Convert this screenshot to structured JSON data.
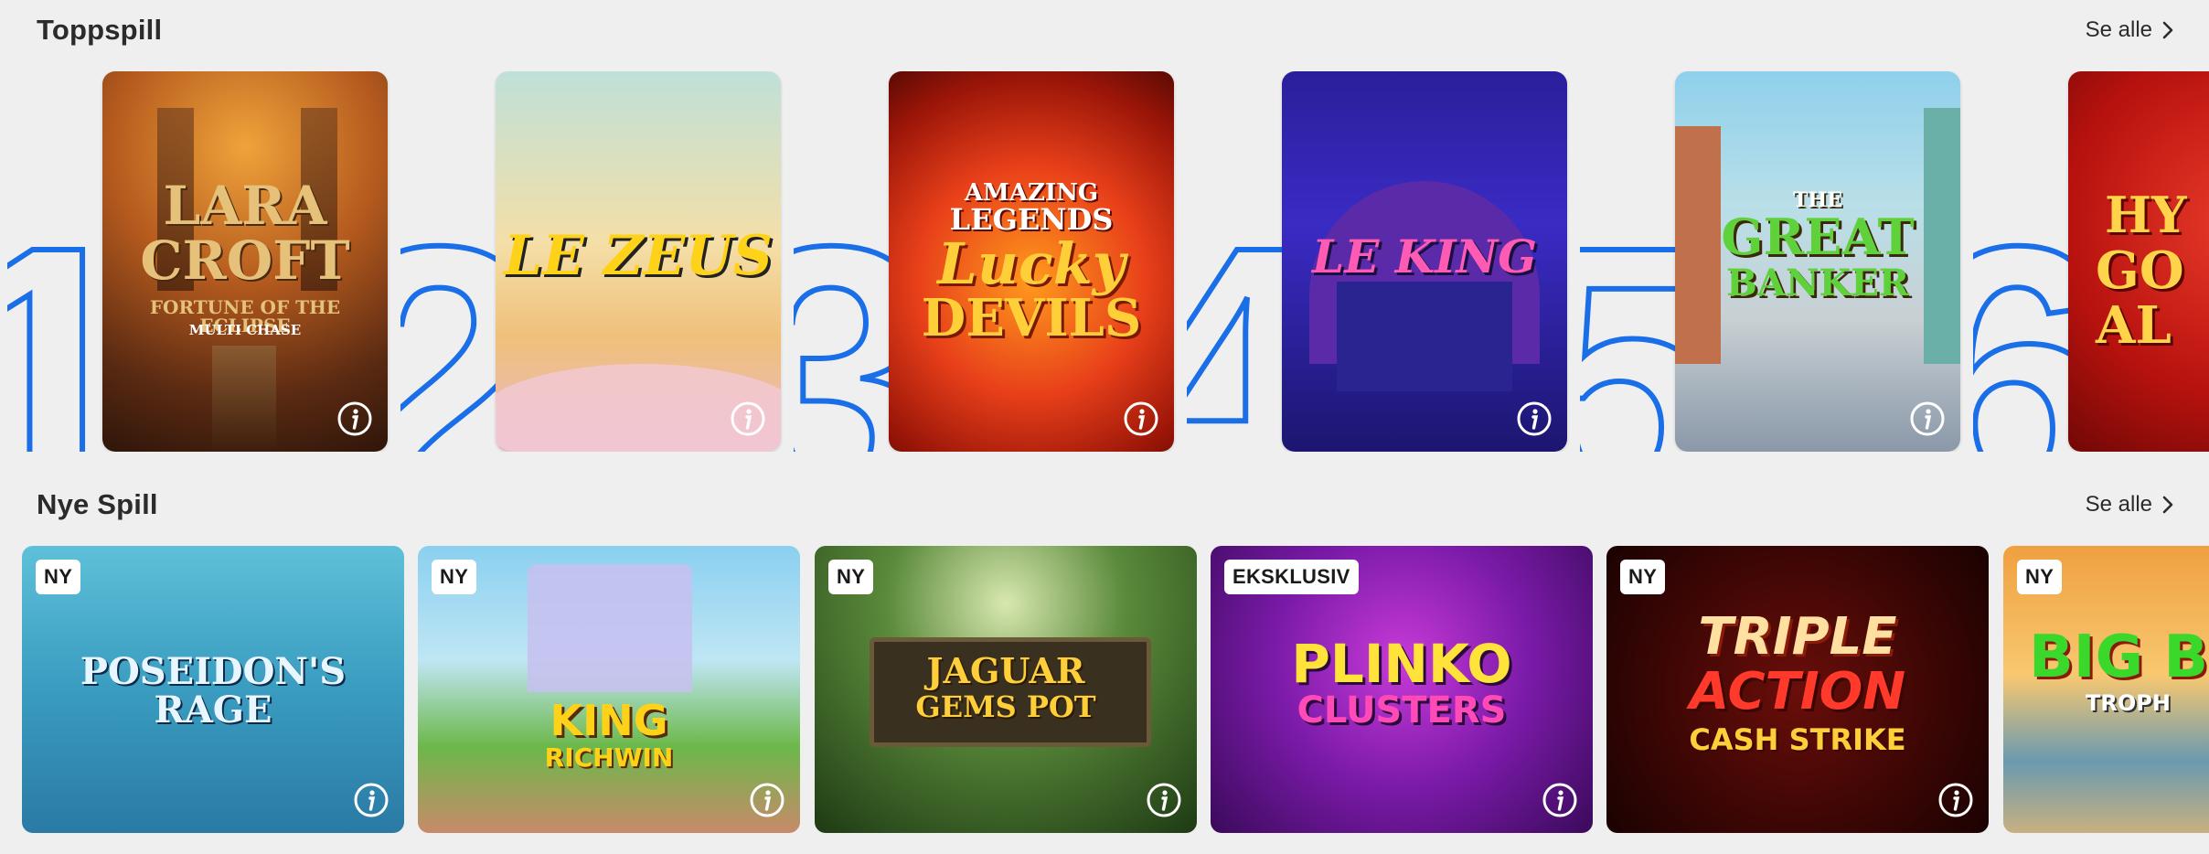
{
  "top_section": {
    "title": "Toppspill",
    "see_all": "Se alle",
    "games": [
      {
        "rank": "1",
        "title_line1": "LARA",
        "title_line2": "CROFT",
        "subtitle": "FORTUNE OF THE ECLIPSE",
        "tag": "MULTI CHASE"
      },
      {
        "rank": "2",
        "title_line1": "LE ZEUS"
      },
      {
        "rank": "3",
        "title_line1": "AMAZING",
        "title_line2": "LEGENDS",
        "title_line3": "Lucky",
        "title_line4": "DEVILS"
      },
      {
        "rank": "4",
        "title_line1": "LE KING"
      },
      {
        "rank": "5",
        "title_line1": "THE",
        "title_line2": "GREAT",
        "title_line3": "BANKER"
      },
      {
        "rank": "6",
        "title_line1": "HY",
        "title_line2": "GO",
        "title_line3": "AL"
      }
    ]
  },
  "new_section": {
    "title": "Nye Spill",
    "see_all": "Se alle",
    "games": [
      {
        "badge": "NY",
        "title_line1": "POSEIDON'S",
        "title_line2": "RAGE"
      },
      {
        "badge": "NY",
        "title_line1": "KING",
        "title_line2": "RICHWIN"
      },
      {
        "badge": "NY",
        "title_line1": "JAGUAR",
        "title_line2": "GEMS POT"
      },
      {
        "badge": "EKSKLUSIV",
        "title_line1": "PLINKO",
        "title_line2": "CLUSTERS"
      },
      {
        "badge": "NY",
        "title_line1": "TRIPLE",
        "title_line2": "ACTION",
        "title_line3": "CASH STRIKE"
      },
      {
        "badge": "NY",
        "title_line1": "BIG B",
        "title_line2": "TROPH"
      }
    ]
  },
  "colors": {
    "rank_outline": "#1a6fe8",
    "background": "#efefef"
  },
  "icons": [
    "chevron-right-icon",
    "info-icon"
  ]
}
